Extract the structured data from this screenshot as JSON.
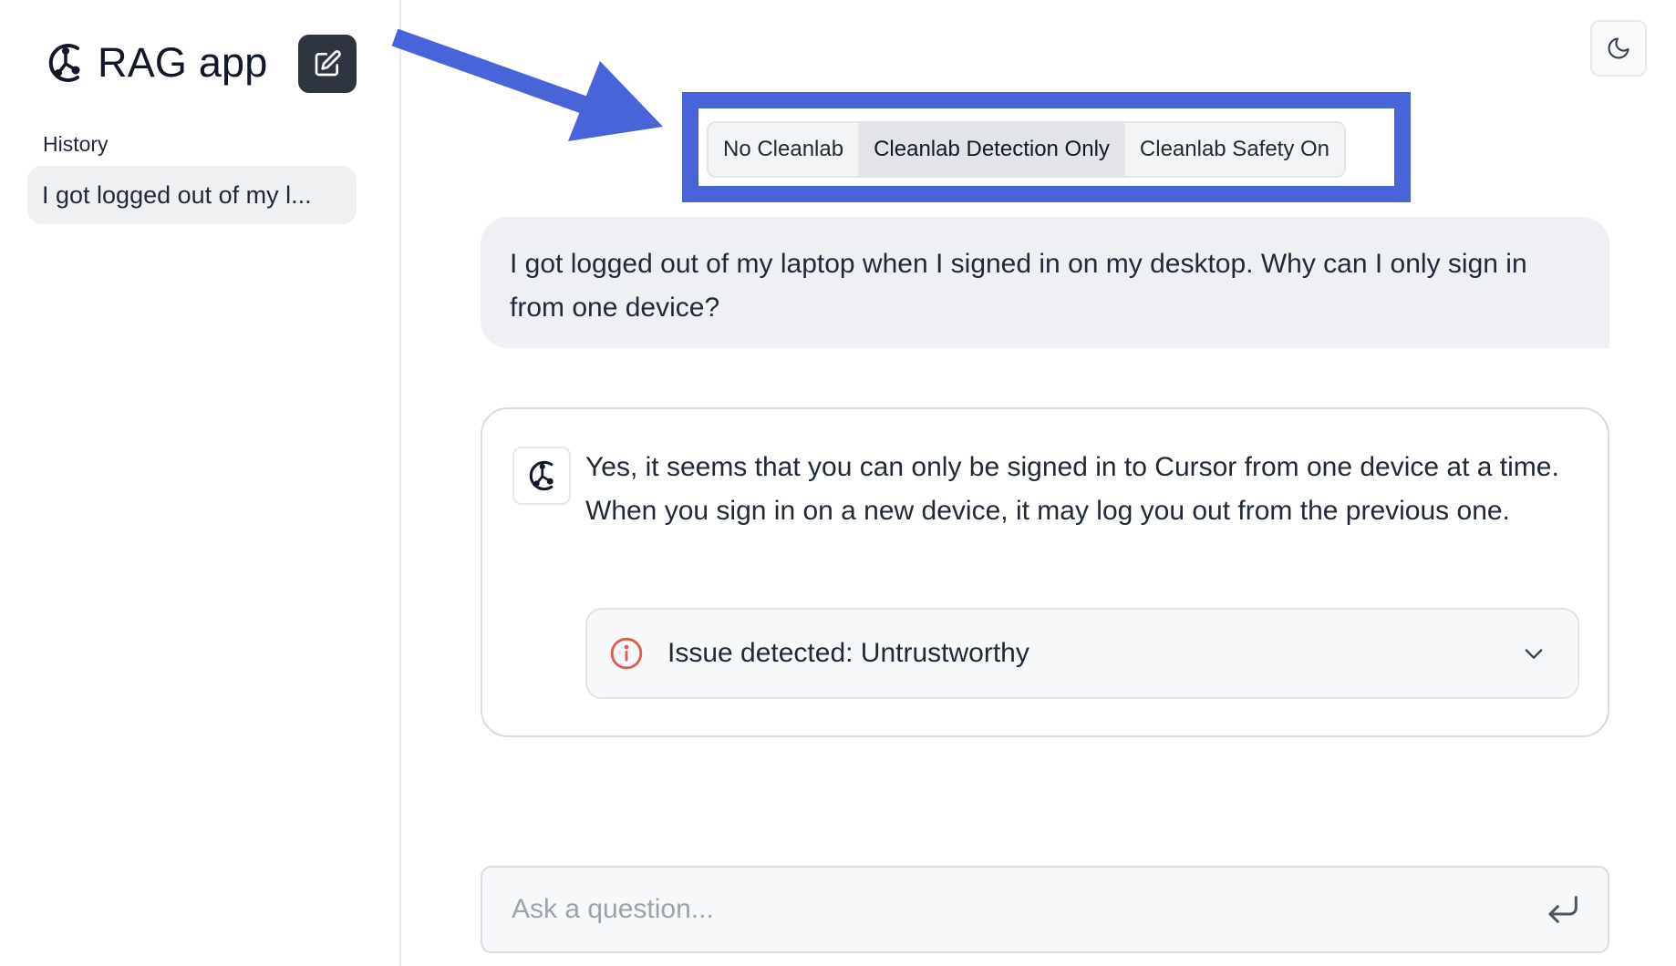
{
  "app": {
    "title": "RAG app",
    "icons": {
      "logo": "cleanlab-logo-icon",
      "new_chat": "edit-icon",
      "theme": "moon-icon"
    }
  },
  "sidebar": {
    "history_label": "History",
    "history_items": [
      {
        "label": "I got logged out of my l..."
      }
    ]
  },
  "mode_selector": {
    "options": [
      "No Cleanlab",
      "Cleanlab Detection Only",
      "Cleanlab Safety On"
    ],
    "selected": "Cleanlab Detection Only"
  },
  "conversation": {
    "user_message": "I got logged out of my laptop when I signed in on my desktop. Why can I only sign in from one device?",
    "bot_message": "Yes, it seems that you can only be signed in to Cursor from one device at a time. When you sign in on a new device, it may log you out from the previous one.",
    "issue": {
      "label": "Issue detected: Untrustworthy",
      "icon": "alert-circle-icon",
      "color": "#e05b4c"
    }
  },
  "input": {
    "placeholder": "Ask a question...",
    "value": "",
    "icon": "enter-icon"
  },
  "annotation": {
    "color": "#4964d8"
  }
}
